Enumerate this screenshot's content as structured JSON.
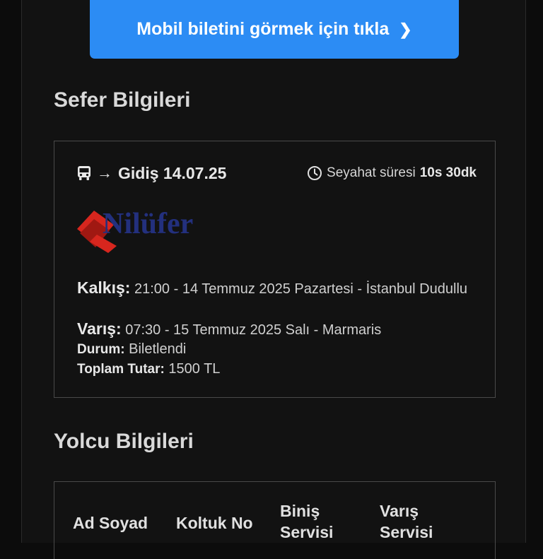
{
  "mobile_ticket": {
    "label": "Mobil biletini görmek için tıkla"
  },
  "trip_section": {
    "title": "Sefer Bilgileri"
  },
  "trip": {
    "direction": "Gidiş 14.07.25",
    "duration_label": "Seyahat süresi",
    "duration_value": "10s 30dk",
    "logo_text": "Nilüfer",
    "departure_label": "Kalkış:",
    "departure_value": "21:00 - 14 Temmuz 2025 Pazartesi - İstanbul Dudullu",
    "arrival_label": "Varış:",
    "arrival_value": "07:30 - 15 Temmuz 2025 Salı - Marmaris",
    "status_label": "Durum:",
    "status_value": "Biletlendi",
    "total_label": "Toplam Tutar:",
    "total_value": "1500 TL"
  },
  "passenger_section": {
    "title": "Yolcu Bilgileri"
  },
  "passenger_table": {
    "headers": [
      "Ad Soyad",
      "Koltuk No",
      "Biniş Servisi",
      "Varış Servisi"
    ]
  },
  "colors": {
    "accent": "#2c8cf4",
    "background": "#121212",
    "border": "#4a4a4a"
  },
  "icons": [
    "bus-icon",
    "arrow-right-icon",
    "clock-icon",
    "chevron-right-icon",
    "brand-logo"
  ]
}
